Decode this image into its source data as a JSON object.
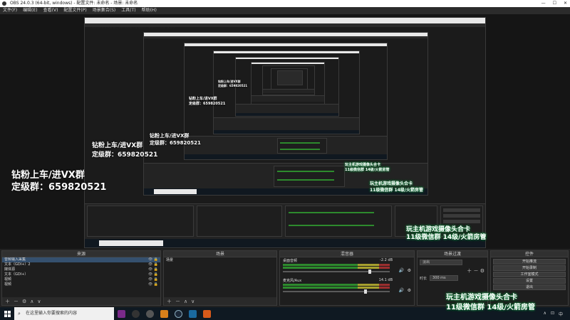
{
  "window": {
    "title": "OBS 24.0.3 (64-bit, windows) - 配置文件: 未命名 - 场景: 未命名",
    "controls": [
      "—",
      "☐",
      "✕"
    ]
  },
  "menubar": [
    "文件(F)",
    "编辑(E)",
    "查看(V)",
    "配置文件(P)",
    "场景集合(S)",
    "工具(T)",
    "帮助(H)"
  ],
  "nested_title": "OBS 24.0.3 (64-bit, windows) - 配置文件: 未命名 - 场景: 未命名",
  "overlay": {
    "line1": "钻粉上车/进VX群",
    "line2": "定级群：659820521",
    "promo1": "玩主机游戏摄像头合卡",
    "promo2": "11级微信群 14级/火箭房管"
  },
  "docks": {
    "sources": {
      "title": "来源",
      "items": [
        "音频输入采集",
        "文本（GDI+）2",
        "媒体源",
        "文本（GDI+）",
        "视频",
        "视频"
      ]
    },
    "scenes": {
      "title": "场景",
      "items": [
        "场景"
      ]
    },
    "mixer": {
      "title": "混音器",
      "channels": [
        {
          "name": "桌面音频",
          "db": "-2.2 dB",
          "level": 0.82
        },
        {
          "name": "麦克风/Aux",
          "db": "14.1 dB",
          "level": 0.78
        }
      ]
    },
    "transitions": {
      "title": "场景过渡",
      "selected": "淡出",
      "duration_label": "时长",
      "duration_value": "300 ms"
    },
    "controls": {
      "title": "控件",
      "buttons": [
        "开始推流",
        "开始录制",
        "工作室模式",
        "设置",
        "退出"
      ]
    }
  },
  "taskbar": {
    "search_placeholder": "在这里输入你要搜索的内容",
    "icon_colors": [
      "#7a2a8a",
      "#333333",
      "#555555",
      "#d8801a",
      "#1b2838",
      "#1a6aa0",
      "#d85a1a"
    ],
    "tray": [
      "∧",
      "⊡",
      "中"
    ]
  },
  "colors": {
    "accent": "#35506e",
    "promo_glow": "#0a8a3a"
  }
}
